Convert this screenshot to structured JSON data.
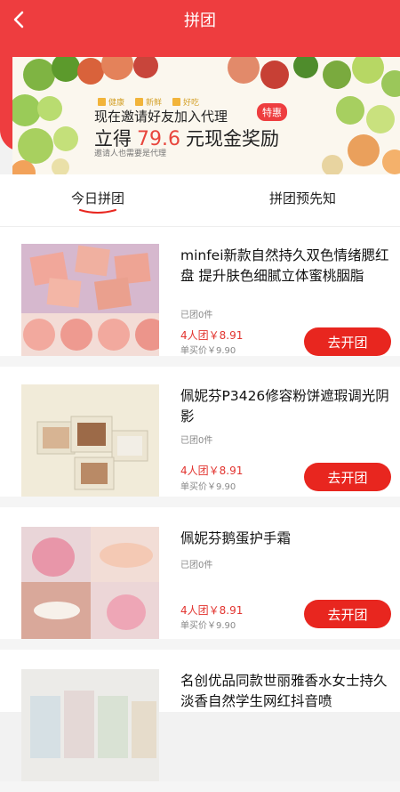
{
  "nav": {
    "title": "拼团"
  },
  "banner": {
    "tags": [
      "健康",
      "新鲜",
      "好吃"
    ],
    "line1": "现在邀请好友加入代理",
    "special": "特惠",
    "line2_prefix": "立得",
    "amount": "79.6",
    "line2_suffix": "元现金奖励",
    "line3": "邀请人也需要是代理"
  },
  "tabs": [
    {
      "label": "今日拼团"
    },
    {
      "label": "拼团预先知"
    }
  ],
  "products": [
    {
      "name": "minfei新款自然持久双色情绪腮红盘 提升肤色细腻立体蜜桃胭脂",
      "sold": "已团0件",
      "group_price": "4人团￥8.91",
      "single_price": "单买价￥9.90",
      "button": "去开团"
    },
    {
      "name": "佩妮芬P3426修容粉饼遮瑕调光阴影",
      "sold": "已团0件",
      "group_price": "4人团￥8.91",
      "single_price": "单买价￥9.90",
      "button": "去开团"
    },
    {
      "name": "佩妮芬鹅蛋护手霜",
      "sold": "已团0件",
      "group_price": "4人团￥8.91",
      "single_price": "单买价￥9.90",
      "button": "去开团"
    },
    {
      "name": "名创优品同款世丽雅香水女士持久淡香自然学生网红抖音喷",
      "sold": "",
      "group_price": "",
      "single_price": "",
      "button": ""
    }
  ],
  "colors": {
    "brand": "#ee3d3f",
    "button": "#e8261f",
    "price": "#e2342f"
  },
  "icons": {
    "back": "chevron-left-icon"
  }
}
